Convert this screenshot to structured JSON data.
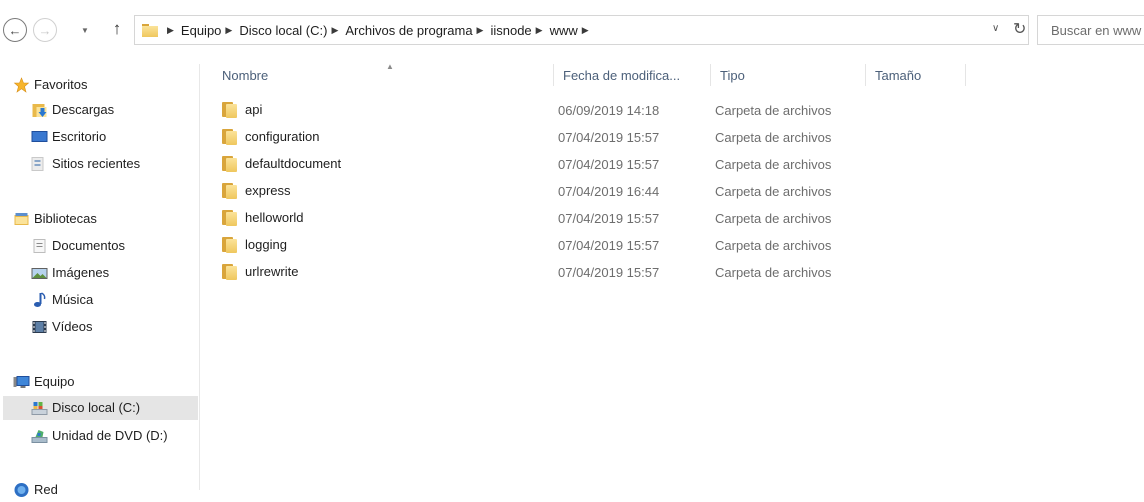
{
  "address_bar": {
    "crumbs": [
      "Equipo",
      "Disco local (C:)",
      "Archivos de programa",
      "iisnode",
      "www"
    ]
  },
  "search": {
    "placeholder": "Buscar en www"
  },
  "nav_pane": {
    "favorites_label": "Favoritos",
    "favorites_items": [
      "Descargas",
      "Escritorio",
      "Sitios recientes"
    ],
    "libraries_label": "Bibliotecas",
    "libraries_items": [
      "Documentos",
      "Imágenes",
      "Música",
      "Vídeos"
    ],
    "computer_label": "Equipo",
    "computer_items": [
      "Disco local (C:)",
      "Unidad de DVD (D:)"
    ],
    "network_label": "Red",
    "selected": "Disco local (C:)"
  },
  "columns": {
    "name": "Nombre",
    "date": "Fecha de modifica...",
    "type": "Tipo",
    "size": "Tamaño",
    "sorted_by": "Nombre"
  },
  "files": [
    {
      "name": "api",
      "date": "06/09/2019 14:18",
      "type": "Carpeta de archivos"
    },
    {
      "name": "configuration",
      "date": "07/04/2019 15:57",
      "type": "Carpeta de archivos"
    },
    {
      "name": "defaultdocument",
      "date": "07/04/2019 15:57",
      "type": "Carpeta de archivos"
    },
    {
      "name": "express",
      "date": "07/04/2019 16:44",
      "type": "Carpeta de archivos"
    },
    {
      "name": "helloworld",
      "date": "07/04/2019 15:57",
      "type": "Carpeta de archivos"
    },
    {
      "name": "logging",
      "date": "07/04/2019 15:57",
      "type": "Carpeta de archivos"
    },
    {
      "name": "urlrewrite",
      "date": "07/04/2019 15:57",
      "type": "Carpeta de archivos"
    }
  ],
  "icons": {
    "back": "back-arrow-icon",
    "forward": "forward-arrow-icon",
    "recent": "chevron-down-icon",
    "up": "up-arrow-icon",
    "refresh": "refresh-icon",
    "favorites": "star-icon",
    "downloads": "downloads-icon",
    "desktop": "desktop-icon",
    "recent_places": "recent-places-icon",
    "libraries": "libraries-icon",
    "documents": "document-icon",
    "pictures": "pictures-icon",
    "music": "music-note-icon",
    "videos": "video-icon",
    "computer": "computer-icon",
    "local_disk": "local-disk-icon",
    "dvd": "dvd-drive-icon",
    "network": "network-icon",
    "folder": "folder-icon"
  }
}
